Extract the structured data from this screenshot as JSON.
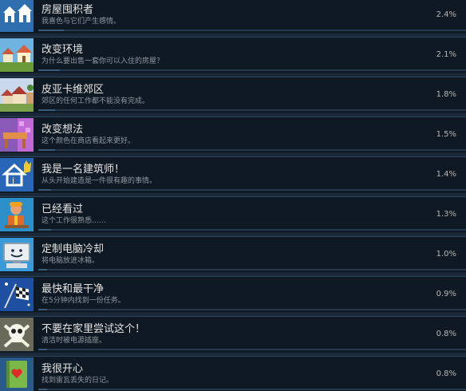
{
  "achievements": [
    {
      "title": "房屋囤积者",
      "desc": "我喜色与它们产生感情。",
      "percent": "2.4%",
      "icon": "houses-icon"
    },
    {
      "title": "改变环境",
      "desc": "为什么要出售一套你可以入住的房屋？",
      "percent": "2.1%",
      "icon": "neighborhood-icon"
    },
    {
      "title": "皮亚卡维郊区",
      "desc": "郊区的任何工作都不能没有完成。",
      "percent": "1.8%",
      "icon": "suburb-icon"
    },
    {
      "title": "改变想法",
      "desc": "这个颜色在商店看起来更好。",
      "percent": "1.5%",
      "icon": "paint-furniture-icon"
    },
    {
      "title": "我是一名建筑师！",
      "desc": "从头开始建造是一件很有趣的事情。",
      "percent": "1.4%",
      "icon": "architect-icon"
    },
    {
      "title": "已经看过",
      "desc": "这个工作很熟悉……",
      "percent": "1.3%",
      "icon": "worker-icon"
    },
    {
      "title": "定制电脑冷却",
      "desc": "将电脑放进冰箱。",
      "percent": "1.0%",
      "icon": "computer-icon"
    },
    {
      "title": "最快和最干净",
      "desc": "在5分钟内找到一份任务。",
      "percent": "0.9%",
      "icon": "checkered-flag-icon"
    },
    {
      "title": "不要在家里尝试这个！",
      "desc": "清洁时被电源插座。",
      "percent": "0.8%",
      "icon": "skull-icon"
    },
    {
      "title": "我很开心",
      "desc": "找到雷瓦丢失的日记。",
      "percent": "0.8%",
      "icon": "diary-icon"
    }
  ]
}
